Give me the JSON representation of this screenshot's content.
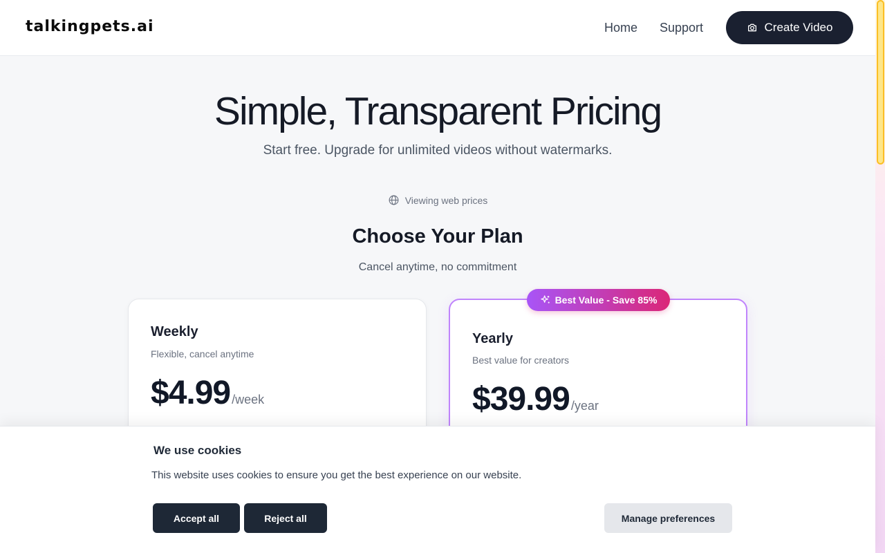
{
  "header": {
    "logo": "talkingpets.ai",
    "nav": {
      "home": "Home",
      "support": "Support"
    },
    "cta_label": "Create Video"
  },
  "hero": {
    "title": "Simple, Transparent Pricing",
    "subtitle": "Start free. Upgrade for unlimited videos without watermarks."
  },
  "pricing": {
    "web_prices_note": "Viewing web prices",
    "section_title": "Choose Your Plan",
    "section_subtitle": "Cancel anytime, no commitment",
    "badge": "Best Value - Save 85%",
    "plans": [
      {
        "name": "Weekly",
        "description": "Flexible, cancel anytime",
        "price": "$4.99",
        "period": "/week"
      },
      {
        "name": "Yearly",
        "description": "Best value for creators",
        "price": "$39.99",
        "period": "/year"
      }
    ]
  },
  "cookie_banner": {
    "title": "We use cookies",
    "text": "This website uses cookies to ensure you get the best experience on our website.",
    "accept_label": "Accept all",
    "reject_label": "Reject all",
    "manage_label": "Manage preferences"
  },
  "colors": {
    "primary_dark": "#1a2030",
    "accent_purple": "#a855f7",
    "accent_pink": "#db2777"
  },
  "icons": {
    "camera": "camera-icon",
    "globe": "globe-icon",
    "sparkle": "sparkle-icon"
  }
}
